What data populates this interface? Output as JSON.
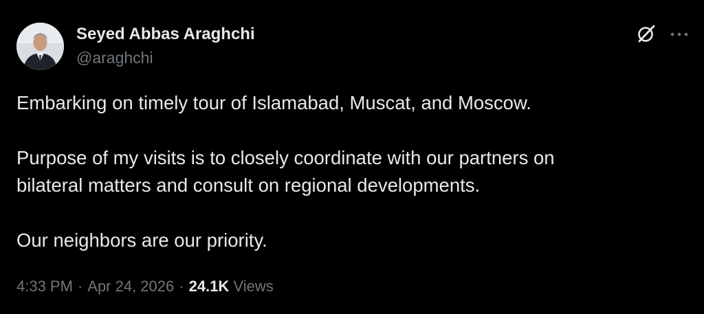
{
  "author": {
    "name": "Seyed Abbas Araghchi",
    "handle": "@araghchi"
  },
  "tweet": {
    "paragraphs": [
      "Embarking on timely tour of Islamabad, Muscat, and Moscow.",
      "Purpose of my visits is to closely coordinate with our partners on\nbilateral matters and consult on regional developments.",
      "Our neighbors are our priority."
    ]
  },
  "meta": {
    "time": "4:33 PM",
    "separator": "·",
    "date": "Apr 24, 2026",
    "views_count": "24.1K",
    "views_label": "Views"
  },
  "icons": {
    "grok": "grok-icon",
    "more": "more-options-icon"
  },
  "colors": {
    "background": "#000000",
    "primary_text": "#e7e9ea",
    "secondary_text": "#71767b"
  }
}
